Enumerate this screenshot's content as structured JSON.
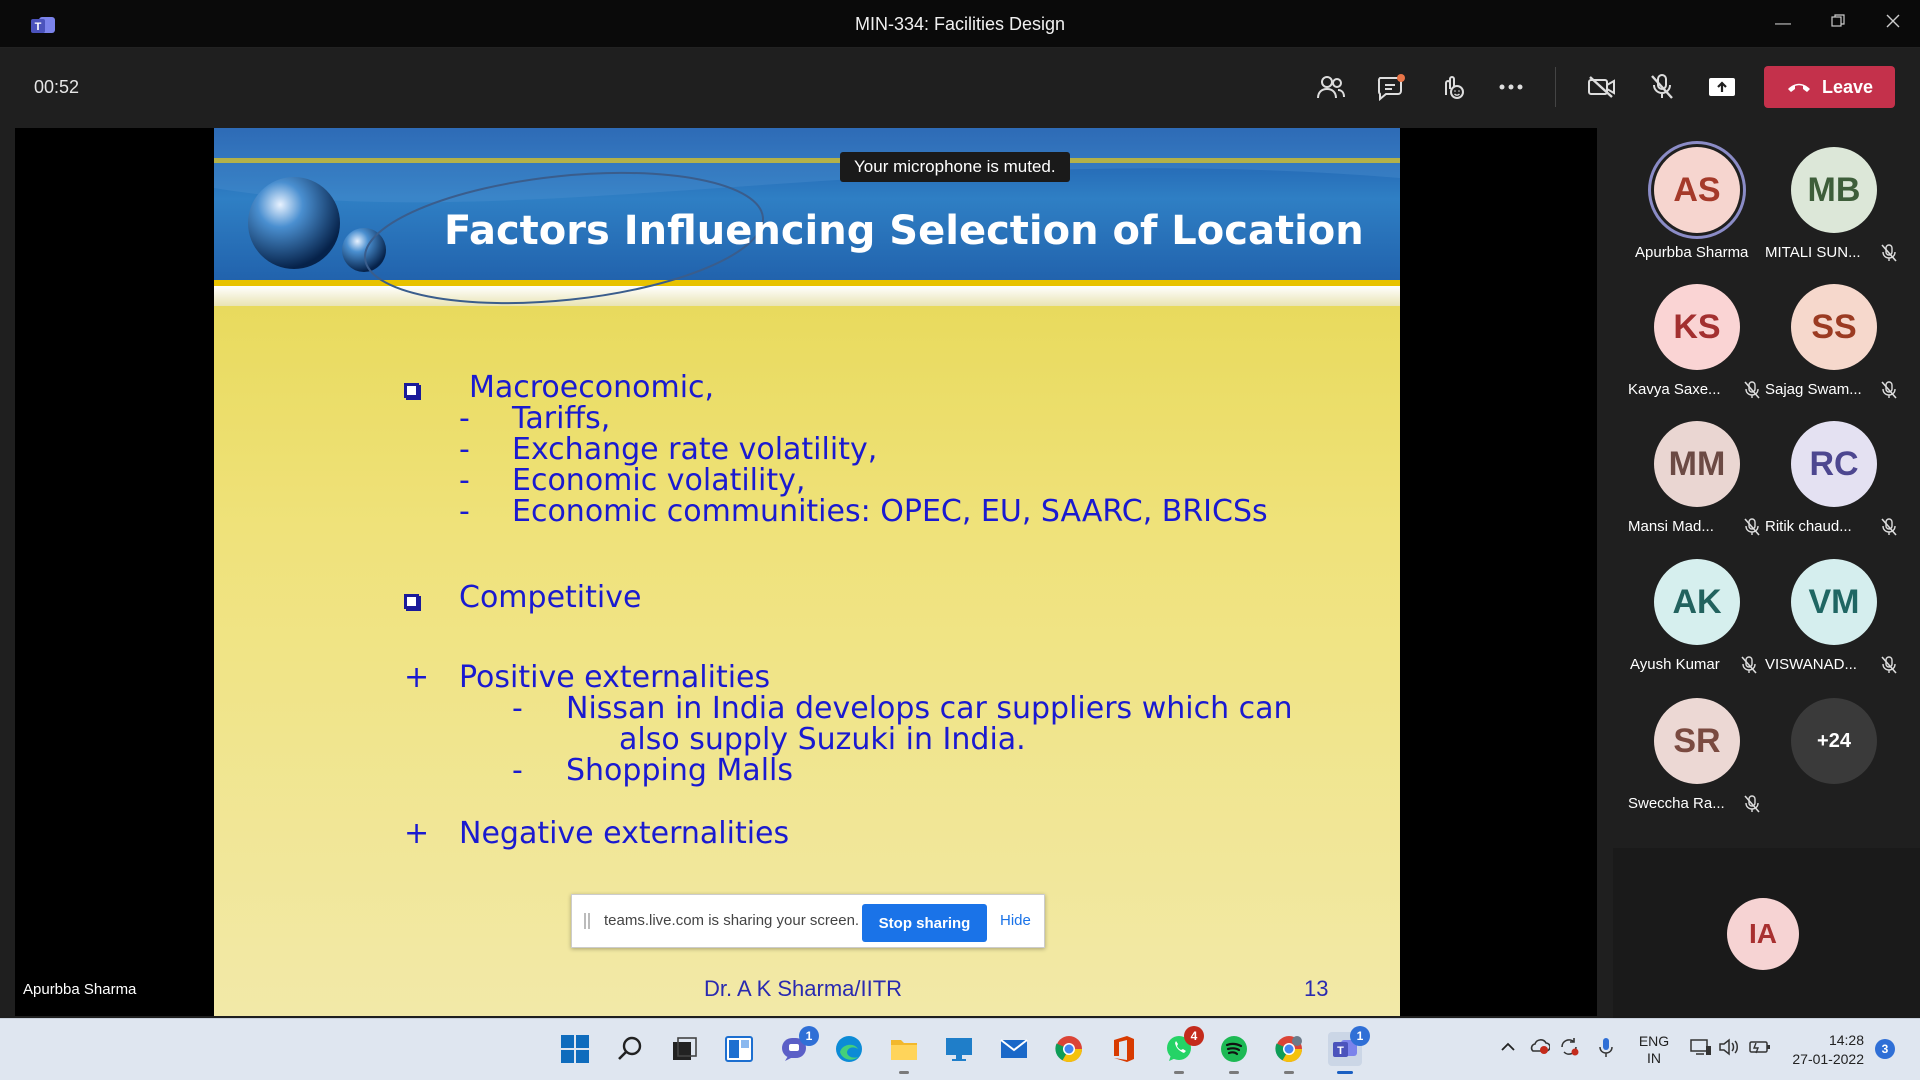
{
  "window": {
    "title": "MIN-334: Facilities Design"
  },
  "toolbar": {
    "timer": "00:52",
    "leave_label": "Leave"
  },
  "toast": {
    "muted": "Your microphone is muted."
  },
  "slide": {
    "title": "Factors Influencing Selection of Location",
    "macro": {
      "heading": "Macroeconomic,",
      "items": [
        "Tariffs,",
        "Exchange rate volatility,",
        "Economic volatility,",
        "Economic communities: OPEC, EU, SAARC, BRICSs"
      ]
    },
    "competitive": "Competitive",
    "positive": {
      "heading": "Positive externalities",
      "item1_line1": "Nissan in India develops car suppliers which can",
      "item1_line2": "also supply Suzuki in India.",
      "item2": "Shopping Malls"
    },
    "negative": "Negative externalities",
    "dash": "-",
    "plus": "+",
    "footer_author": "Dr. A K Sharma/IITR",
    "page_number": "13"
  },
  "share_bar": {
    "message": "teams.live.com is sharing your screen.",
    "stop_label": "Stop sharing",
    "hide_label": "Hide"
  },
  "presenter_name": "Apurbba Sharma",
  "participants": [
    {
      "initials": "AS",
      "name": "Apurbba Sharma",
      "muted": false,
      "speaking": true,
      "bg": "#f6d5cf",
      "fg": "#a53a2a"
    },
    {
      "initials": "MB",
      "name": "MITALI SUN...",
      "muted": true,
      "bg": "#dce7d8",
      "fg": "#3e5e3a"
    },
    {
      "initials": "KS",
      "name": "Kavya Saxe...",
      "muted": true,
      "bg": "#fad4d4",
      "fg": "#a33030"
    },
    {
      "initials": "SS",
      "name": "Sajag Swam...",
      "muted": true,
      "bg": "#f6d8cc",
      "fg": "#9b3b22"
    },
    {
      "initials": "MM",
      "name": "Mansi Mad...",
      "muted": true,
      "bg": "#ead6d2",
      "fg": "#6c4a44"
    },
    {
      "initials": "RC",
      "name": "Ritik chaud...",
      "muted": true,
      "bg": "#e4e1f2",
      "fg": "#4d4790"
    },
    {
      "initials": "AK",
      "name": "Ayush Kumar",
      "muted": true,
      "bg": "#d6efee",
      "fg": "#22625e"
    },
    {
      "initials": "VM",
      "name": "VISWANAD...",
      "muted": true,
      "bg": "#d5eeee",
      "fg": "#1f6663"
    },
    {
      "initials": "SR",
      "name": "Sweccha Ra...",
      "muted": true,
      "bg": "#ecd8d4",
      "fg": "#7a4a40"
    }
  ],
  "overflow_count": "+24",
  "self_tile": {
    "initials": "IA",
    "bg": "#f6d3d3",
    "fg": "#a83030"
  },
  "taskbar": {
    "badges": {
      "chat": "1",
      "whatsapp": "4",
      "teams": "1",
      "notifications": "3"
    },
    "lang_line1": "ENG",
    "lang_line2": "IN",
    "time": "14:28",
    "date": "27-01-2022"
  },
  "colors": {
    "leave": "#c4314b",
    "slide_text": "#1a1ad0",
    "share_blue": "#1a73e8"
  }
}
